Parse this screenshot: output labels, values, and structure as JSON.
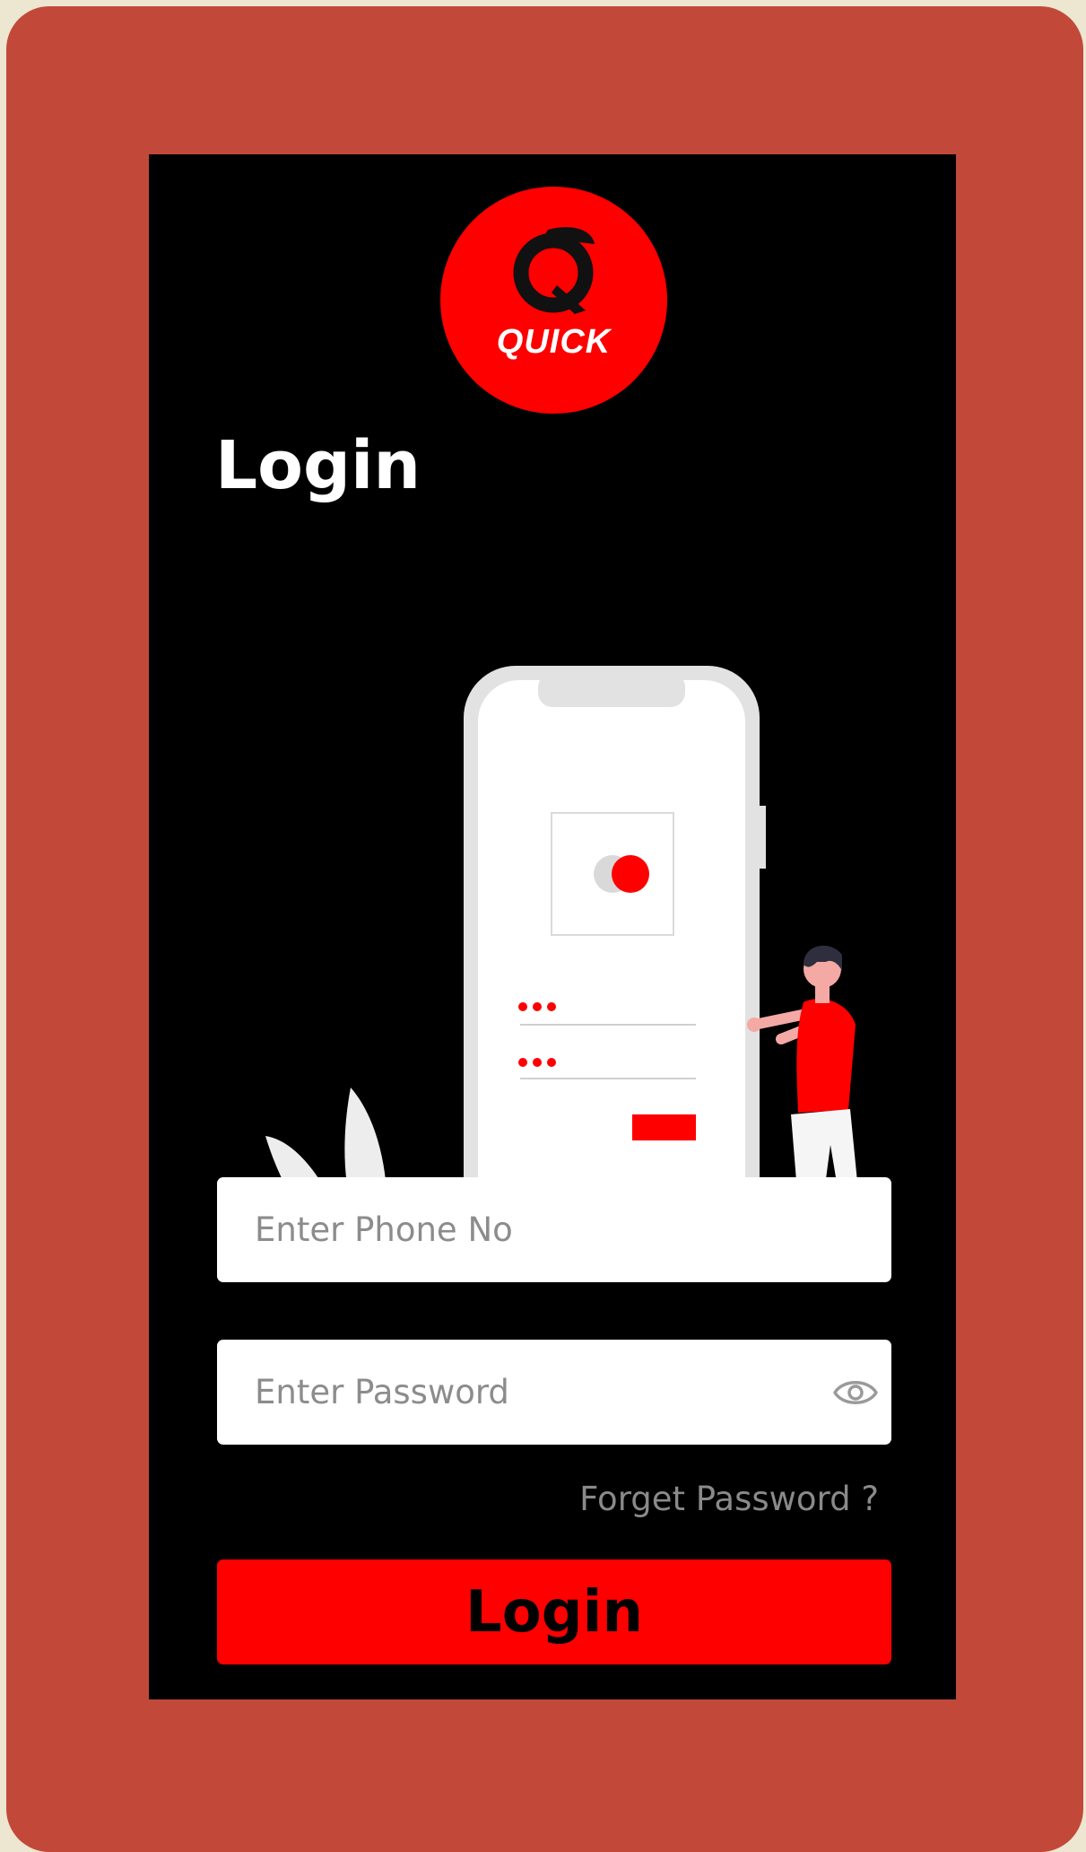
{
  "logo": {
    "text": "QUICK",
    "icon": "q-logo-icon"
  },
  "title": "Login",
  "illustration": {
    "icon": "phone-login-illustration"
  },
  "phone_field": {
    "placeholder": "Enter Phone No",
    "value": ""
  },
  "password_field": {
    "placeholder": "Enter Password",
    "value": "",
    "toggle_icon": "eye-icon"
  },
  "forgot_password": "Forget Password ?",
  "login_button": "Login",
  "colors": {
    "frame": "#C2493A",
    "background": "#EDE7D1",
    "screen": "#000000",
    "accent": "#FF0000",
    "field": "#FFFFFF",
    "muted_text": "#8A8A8A"
  }
}
